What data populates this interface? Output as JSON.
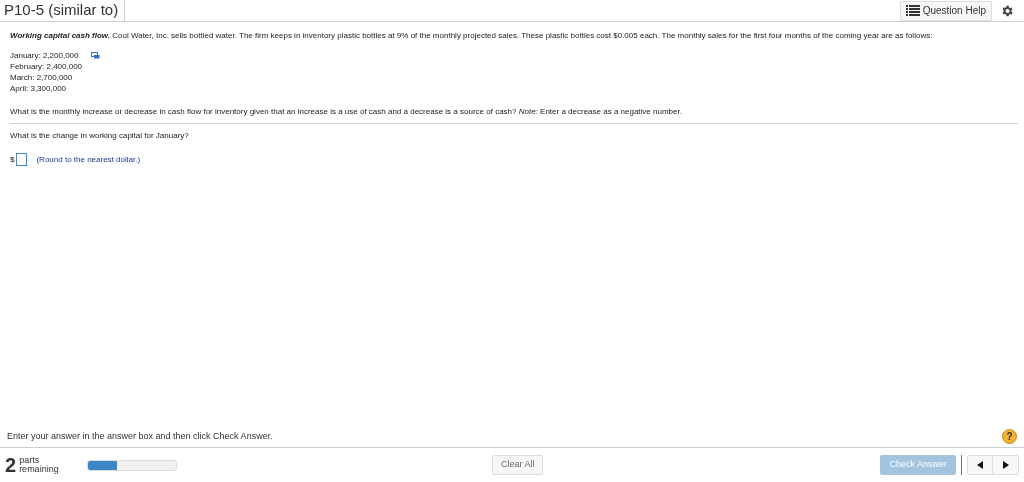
{
  "header": {
    "title": "P10-5 (similar to)",
    "help_button": "Question Help"
  },
  "problem": {
    "lead": "Working capital cash flow.",
    "text": "Cool Water, Inc. sells bottled water.  The firm keeps in inventory plastic bottles at 9% of the monthly projected sales.  These plastic bottles cost $0.005 each.  The monthly sales for the first four months of the coming year are as follows:"
  },
  "sales": [
    "January:  2,200,000",
    "February:  2,400,000",
    "March:  2,700,000",
    "April:  3,300,000"
  ],
  "question": "What is the monthly increase or decrease in cash flow for inventory given that an increase is a use of cash and a decrease is a source of cash?  *Note:*  Enter a decrease as a negative number.",
  "part": {
    "question": "What is the change in working capital for January?",
    "currency": "$",
    "hint": "(Round to the nearest dollar.)"
  },
  "footer": {
    "instruction": "Enter your answer in the answer box and then click Check Answer.",
    "help_icon": "?",
    "parts_count": "2",
    "parts_label": "parts remaining",
    "progress": {
      "level": 0.33
    },
    "clear_button": "Clear All",
    "check_button": {
      "label": "Check Answer",
      "disabled": true
    }
  }
}
